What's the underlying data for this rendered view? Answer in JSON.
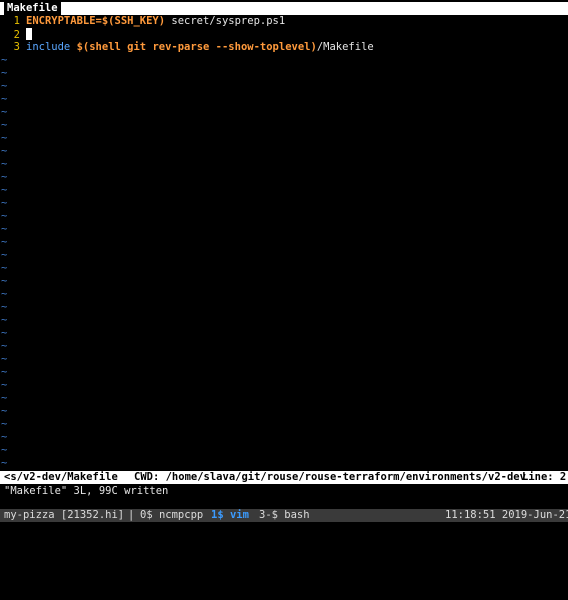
{
  "tabline": {
    "active_tab": "Makefile"
  },
  "editor": {
    "lines": [
      {
        "num": "1",
        "kw": "ENCRYPTABLE=$(SSH_KEY)",
        "rest": " secret/sysprep.ps1"
      },
      {
        "num": "2"
      },
      {
        "num": "3",
        "include": "include",
        "expr": "$(shell git rev-parse --show-toplevel)",
        "rest": "/Makefile"
      }
    ],
    "filler": "~"
  },
  "statusline": {
    "file": "<s/v2-dev/Makefile",
    "cwd": "CWD: /home/slava/git/rouse/rouse-terraform/environments/v2-dev",
    "line": "Line: 2"
  },
  "cmdline": {
    "message": "\"Makefile\" 3L, 99C written"
  },
  "tmux": {
    "session": "my-pizza [21352.hi]",
    "separator": "|",
    "windows": [
      {
        "label": "0$ ncmpcpp",
        "active": false
      },
      {
        "label": "1$ vim",
        "active": true
      },
      {
        "label": "3-$ bash",
        "active": false
      }
    ],
    "clock": "11:18:51 2019-Jun-21"
  },
  "colors": {
    "background": "#000000",
    "line_number": "#e8c000",
    "keyword": "#ff9a3c",
    "include": "#5aa7ff",
    "tilde": "#3f78c6",
    "tmux_bar": "#3a3a3a",
    "tmux_active": "#3b9bff"
  }
}
